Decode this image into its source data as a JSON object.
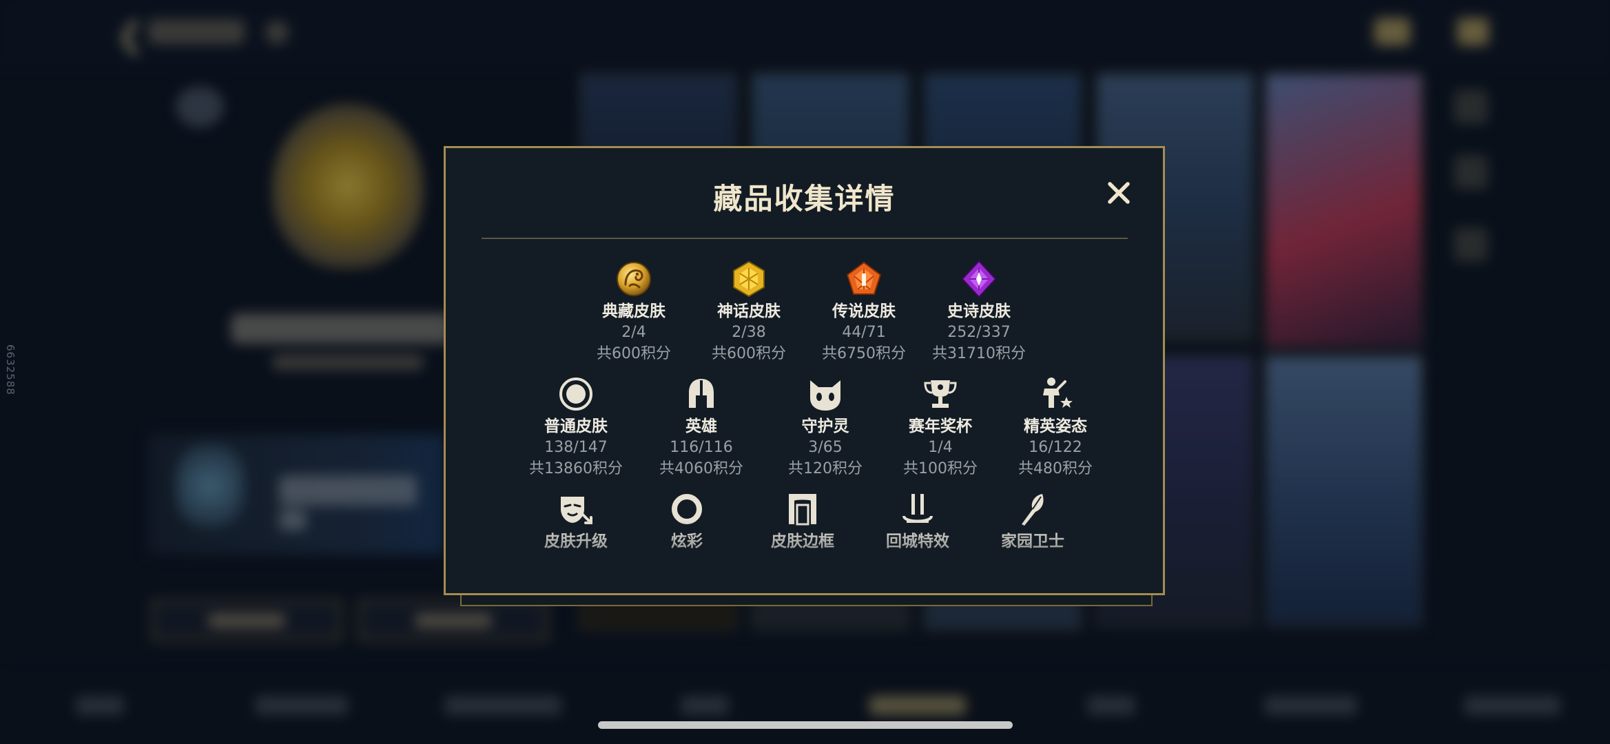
{
  "background": {
    "side_watermark": "6632588"
  },
  "dialog": {
    "title": "藏品收集详情",
    "close_label": "✕",
    "colors": {
      "frame": "#a58c52",
      "panel": "#131c24",
      "title": "#f0e6cc"
    },
    "rows": [
      [
        {
          "icon": "dragon-medal-icon",
          "name": "典藏皮肤",
          "count": "2/4",
          "points": "共600积分"
        },
        {
          "icon": "gold-gem-icon",
          "name": "神话皮肤",
          "count": "2/38",
          "points": "共600积分"
        },
        {
          "icon": "orange-gem-icon",
          "name": "传说皮肤",
          "count": "44/71",
          "points": "共6750积分"
        },
        {
          "icon": "purple-gem-icon",
          "name": "史诗皮肤",
          "count": "252/337",
          "points": "共31710积分"
        }
      ],
      [
        {
          "icon": "circle-target-icon",
          "name": "普通皮肤",
          "count": "138/147",
          "points": "共13860积分"
        },
        {
          "icon": "helmet-icon",
          "name": "英雄",
          "count": "116/116",
          "points": "共4060积分"
        },
        {
          "icon": "spirit-face-icon",
          "name": "守护灵",
          "count": "3/65",
          "points": "共120积分"
        },
        {
          "icon": "trophy-icon",
          "name": "赛年奖杯",
          "count": "1/4",
          "points": "共100积分"
        },
        {
          "icon": "elite-pose-icon",
          "name": "精英姿态",
          "count": "16/122",
          "points": "共480积分"
        }
      ],
      [
        {
          "icon": "mask-upgrade-icon",
          "name": "皮肤升级"
        },
        {
          "icon": "ring-icon",
          "name": "炫彩"
        },
        {
          "icon": "frame-portal-icon",
          "name": "皮肤边框"
        },
        {
          "icon": "recall-effect-icon",
          "name": "回城特效"
        },
        {
          "icon": "feather-guard-icon",
          "name": "家园卫士"
        }
      ]
    ]
  }
}
